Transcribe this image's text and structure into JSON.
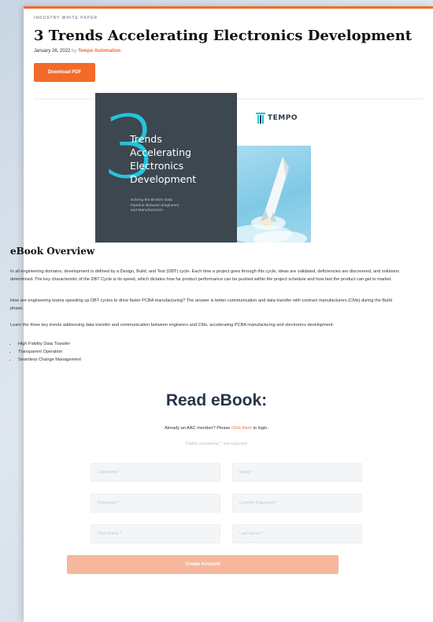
{
  "header": {
    "kicker": "INDUSTRY WHITE PAPER",
    "title": "3 Trends Accelerating Electronics Development",
    "date": "January 26, 2022",
    "by": "by",
    "author": "Tempo Automation",
    "download_label": "Download PDF"
  },
  "cover": {
    "number": "3",
    "words": "Trends\nAccelerating\nElectronics\nDevelopment",
    "subtitle": "Solving the Broken Data\nPipeline Between Engineers\nand Manufacturers",
    "logo_text": "TEMPO",
    "colors": {
      "dark": "#3d4750",
      "accent": "#24c4dc",
      "sky": "#8fd0e9"
    }
  },
  "overview": {
    "heading": "eBook Overview",
    "p1": "In all engineering domains, development is defined by a Design, Build, and Test (DBT) cycle. Each time a project goes through this cycle, ideas are validated, deficiencies are discovered, and solutions determined. The key characteristic of the DBT Cycle is its speed, which dictates how far product performance can be pushed within the project schedule and how fast the product can get to market.",
    "p2": "How are engineering teams speeding up DBT cycles to drive faster PCBA manufacturing? The answer is better communication and data transfer with contract manufacturers (CMs) during the Build phase.",
    "p3": "Learn the three key trends addressing data transfer and communication between engineers and CMs, accelerating PCBA manufacturing and electronics development:",
    "bullets": [
      "High Fidelity Data Transfer",
      "Transparent Operation",
      "Seamless Change Management"
    ]
  },
  "form": {
    "heading": "Read eBook:",
    "already_prefix": "Already an AAC member? Please",
    "already_link": "Click Here",
    "already_suffix": "to login.",
    "required_note": "Fields containing * are required",
    "username_placeholder": "Username *",
    "email_placeholder": "Email *",
    "password_placeholder": "Password *",
    "confirm_placeholder": "Confirm Password *",
    "first_placeholder": "First Name *",
    "last_placeholder": "Last Name *",
    "submit_label": "Create Account"
  },
  "colors": {
    "brand": "#f26b2b",
    "submit_disabled": "#f6b79c",
    "heading": "#27344a"
  }
}
